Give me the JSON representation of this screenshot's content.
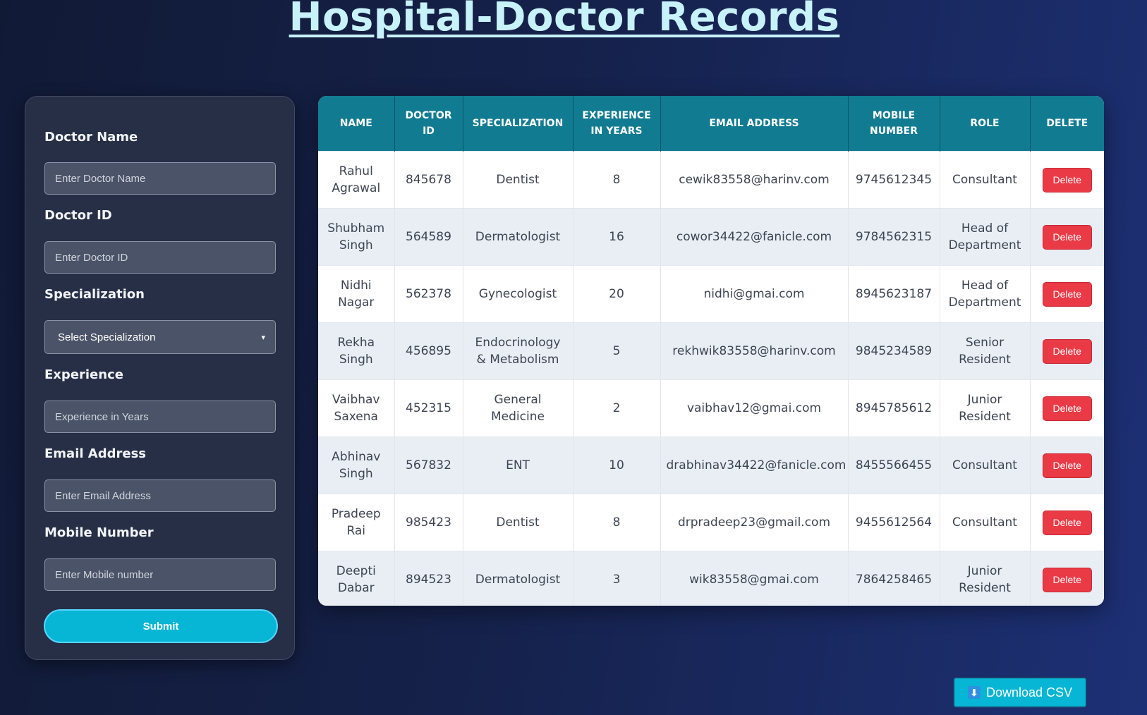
{
  "page": {
    "title": "Hospital-Doctor Records"
  },
  "form": {
    "fields": {
      "doctor_name": {
        "label": "Doctor Name",
        "placeholder": "Enter Doctor Name"
      },
      "doctor_id": {
        "label": "Doctor ID",
        "placeholder": "Enter Doctor ID"
      },
      "specialization": {
        "label": "Specialization",
        "selected": "Select Specialization"
      },
      "experience": {
        "label": "Experience",
        "placeholder": "Experience in Years"
      },
      "email": {
        "label": "Email Address",
        "placeholder": "Enter Email Address"
      },
      "mobile": {
        "label": "Mobile Number",
        "placeholder": "Enter Mobile number"
      }
    },
    "submit_label": "Submit"
  },
  "table": {
    "headers": {
      "name": "NAME",
      "doctor_id": "DOCTOR ID",
      "specialization": "SPECIALIZATION",
      "experience": "EXPERIENCE IN YEARS",
      "email": "EMAIL ADDRESS",
      "mobile": "MOBILE NUMBER",
      "role": "ROLE",
      "delete": "DELETE"
    },
    "delete_label": "Delete",
    "rows": [
      {
        "name": "Rahul Agrawal",
        "id": "845678",
        "specialization": "Dentist",
        "experience": "8",
        "email": "cewik83558@harinv.com",
        "mobile": "9745612345",
        "role": "Consultant"
      },
      {
        "name": "Shubham Singh",
        "id": "564589",
        "specialization": "Dermatologist",
        "experience": "16",
        "email": "cowor34422@fanicle.com",
        "mobile": "9784562315",
        "role": "Head of Department"
      },
      {
        "name": "Nidhi Nagar",
        "id": "562378",
        "specialization": "Gynecologist",
        "experience": "20",
        "email": "nidhi@gmai.com",
        "mobile": "8945623187",
        "role": "Head of Department"
      },
      {
        "name": "Rekha Singh",
        "id": "456895",
        "specialization": "Endocrinology & Metabolism",
        "experience": "5",
        "email": "rekhwik83558@harinv.com",
        "mobile": "9845234589",
        "role": "Senior Resident"
      },
      {
        "name": "Vaibhav Saxena",
        "id": "452315",
        "specialization": "General Medicine",
        "experience": "2",
        "email": "vaibhav12@gmai.com",
        "mobile": "8945785612",
        "role": "Junior Resident"
      },
      {
        "name": "Abhinav Singh",
        "id": "567832",
        "specialization": "ENT",
        "experience": "10",
        "email": "drabhinav34422@fanicle.com",
        "mobile": "8455566455",
        "role": "Consultant"
      },
      {
        "name": "Pradeep Rai",
        "id": "985423",
        "specialization": "Dentist",
        "experience": "8",
        "email": "drpradeep23@gmail.com",
        "mobile": "9455612564",
        "role": "Consultant"
      },
      {
        "name": "Deepti Dabar",
        "id": "894523",
        "specialization": "Dermatologist",
        "experience": "3",
        "email": "wik83558@gmai.com",
        "mobile": "7864258465",
        "role": "Junior Resident"
      }
    ]
  },
  "download": {
    "label": "Download CSV",
    "icon": "download-arrow-icon",
    "icon_glyph": "⬇"
  }
}
